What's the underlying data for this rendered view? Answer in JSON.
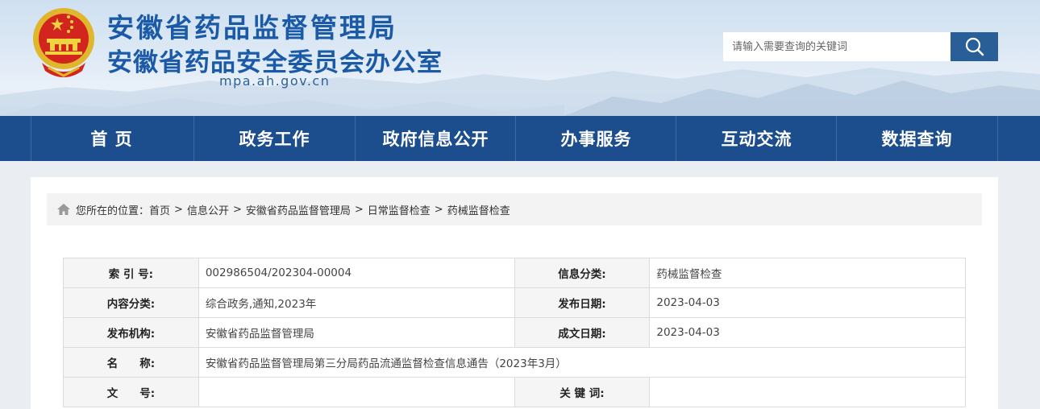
{
  "header": {
    "title_main": "安徽省药品监督管理局",
    "title_sub": "安徽省药品安全委员会办公室",
    "domain": "mpa.ah.gov.cn",
    "search_placeholder": "请输入需要查询的关键词"
  },
  "nav": {
    "items": [
      "首 页",
      "政务工作",
      "政府信息公开",
      "办事服务",
      "互动交流",
      "数据查询"
    ]
  },
  "breadcrumb": {
    "prefix": "您所在的位置：",
    "items": [
      "首页",
      "信息公开",
      "安徽省药品监督管理局",
      "日常监督检查",
      "药械监督检查"
    ],
    "separator": ">"
  },
  "meta": {
    "index_label": "索 引 号:",
    "index_value": "002986504/202304-00004",
    "category_label": "信息分类:",
    "category_value": "药械监督检查",
    "content_label": "内容分类:",
    "content_value": "综合政务,通知,2023年",
    "pubdate_label": "发布日期:",
    "pubdate_value": "2023-04-03",
    "org_label": "发布机构:",
    "org_value": "安徽省药品监督管理局",
    "date_label": "成文日期:",
    "date_value": "2023-04-03",
    "name_label": "名　　称:",
    "name_value": "安徽省药品监督管理局第三分局药品流通监督检查信息通告（2023年3月）",
    "docno_label": "文　　号:",
    "docno_value": "",
    "keyword_label": "关 键 词:",
    "keyword_value": ""
  },
  "colors": {
    "nav_bg": "#1c4e8e",
    "title_blue": "#1a5aa6",
    "search_btn": "#2a5e97"
  },
  "icons": [
    "national-emblem-icon",
    "search-icon",
    "home-icon"
  ]
}
